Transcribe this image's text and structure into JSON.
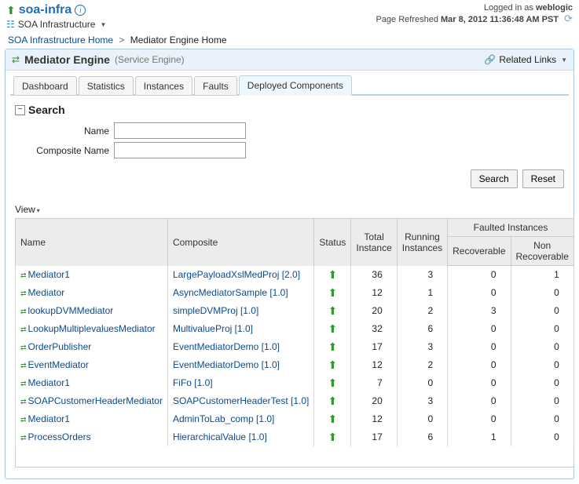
{
  "header": {
    "title": "soa-infra",
    "info_icon": "i",
    "sub_menu": "SOA Infrastructure",
    "logged_in_prefix": "Logged in as ",
    "user": "weblogic",
    "refresh_prefix": "Page Refreshed ",
    "refresh_time": "Mar 8, 2012 11:36:48 AM PST"
  },
  "breadcrumb": {
    "home_label": "SOA Infrastructure Home",
    "current": "Mediator Engine Home"
  },
  "panel": {
    "title": "Mediator Engine",
    "subtitle": "(Service Engine)",
    "related_label": "Related Links"
  },
  "tabs": {
    "items": [
      "Dashboard",
      "Statistics",
      "Instances",
      "Faults",
      "Deployed Components"
    ]
  },
  "search": {
    "heading": "Search",
    "name_label": "Name",
    "composite_label": "Composite Name",
    "name_value": "",
    "composite_value": "",
    "search_btn": "Search",
    "reset_btn": "Reset"
  },
  "view_label": "View",
  "table": {
    "headers": {
      "name": "Name",
      "composite": "Composite",
      "status": "Status",
      "total": "Total Instance",
      "running": "Running Instances",
      "fault_group": "Faulted Instances",
      "recoverable": "Recoverable",
      "nonrecoverable": "Non Recoverable"
    },
    "rows": [
      {
        "name": "Mediator1",
        "composite": "LargePayloadXslMedProj [2.0]",
        "total": 36,
        "running": 3,
        "rec": 0,
        "nrec": 1
      },
      {
        "name": "Mediator",
        "composite": "AsyncMediatorSample [1.0]",
        "total": 12,
        "running": 1,
        "rec": 0,
        "nrec": 0
      },
      {
        "name": "lookupDVMMediator",
        "composite": "simpleDVMProj [1.0]",
        "total": 20,
        "running": 2,
        "rec": 3,
        "nrec": 0
      },
      {
        "name": "LookupMultiplevaluesMediator",
        "composite": "MultivalueProj [1.0]",
        "total": 32,
        "running": 6,
        "rec": 0,
        "nrec": 0
      },
      {
        "name": "OrderPublisher",
        "composite": "EventMediatorDemo [1.0]",
        "total": 17,
        "running": 3,
        "rec": 0,
        "nrec": 0
      },
      {
        "name": "EventMediator",
        "composite": "EventMediatorDemo [1.0]",
        "total": 12,
        "running": 2,
        "rec": 0,
        "nrec": 0
      },
      {
        "name": "Mediator1",
        "composite": "FiFo [1.0]",
        "total": 7,
        "running": 0,
        "rec": 0,
        "nrec": 0
      },
      {
        "name": "SOAPCustomerHeaderMediator",
        "composite": "SOAPCustomerHeaderTest [1.0]",
        "total": 20,
        "running": 3,
        "rec": 0,
        "nrec": 0
      },
      {
        "name": "Mediator1",
        "composite": "AdminToLab_comp [1.0]",
        "total": 12,
        "running": 0,
        "rec": 0,
        "nrec": 0
      },
      {
        "name": "ProcessOrders",
        "composite": "HierarchicalValue [1.0]",
        "total": 17,
        "running": 6,
        "rec": 1,
        "nrec": 0
      }
    ]
  }
}
